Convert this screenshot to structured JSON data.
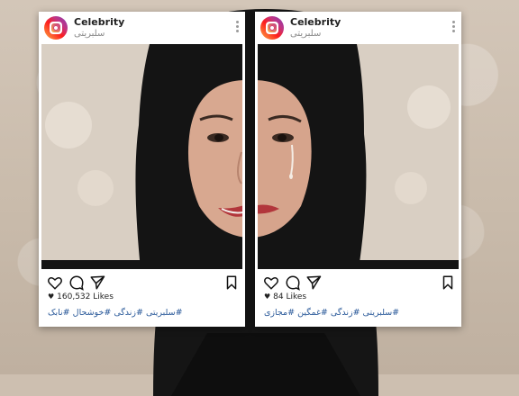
{
  "posts": [
    {
      "account_name": "Celebrity",
      "account_subtitle": "سلبریتی",
      "likes": "160,532 Likes",
      "tags": "#سلبریتی #زندگی #خوشحال #نابک",
      "mood": "happy"
    },
    {
      "account_name": "Celebrity",
      "account_subtitle": "سلبریتی",
      "likes": "84 Likes",
      "tags": "#سلبریتی #زندگی #غمگین #مجازی",
      "mood": "sad"
    }
  ],
  "colors": {
    "hashtag": "#2b5a9a",
    "brand_gradient": [
      "#fcb045",
      "#fd1d1d",
      "#c13584",
      "#833ab4"
    ]
  },
  "icons": [
    "instagram-logo-icon",
    "more-options-icon",
    "heart-icon",
    "comment-icon",
    "share-icon",
    "bookmark-icon"
  ]
}
